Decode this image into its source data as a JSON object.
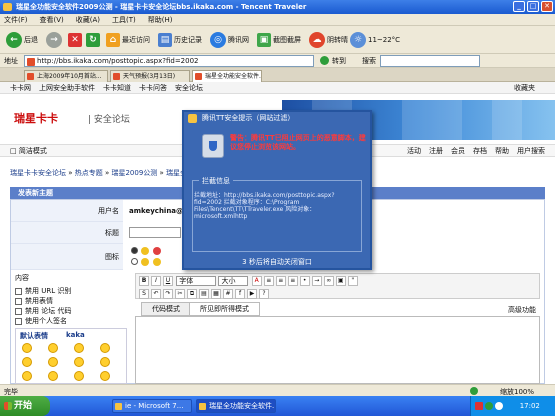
{
  "window": {
    "title": "瑞星全功能安全软件2009公测 - 瑞星卡卡安全论坛bbs.ikaka.com - Tencent Traveler"
  },
  "menu": [
    "文件(F)",
    "查看(V)",
    "收藏(A)",
    "工具(T)",
    "帮助(H)"
  ],
  "toolbar": {
    "back": "后退",
    "home_label": "最近访问",
    "history_label": "历史记录",
    "favorites_label": "腾讯网",
    "mute_label": "截图截屏",
    "weather_label": "阴转晴",
    "temperature": "11~22°C"
  },
  "address": {
    "label": "地址",
    "url": "http://bbs.ikaka.com/posttopic.aspx?fid=2002",
    "go": "转到",
    "search": "搜索"
  },
  "tabs": [
    "上海2009年10月首站...",
    "天气预报(3月13日)",
    "瑞星全功能安全软件..."
  ],
  "page": {
    "topnav": [
      "卡卡网",
      "上网安全助手软件",
      "卡卡知道",
      "卡卡问答",
      "安全论坛"
    ],
    "topnav_right": "收藏夹",
    "logo": "瑞星卡卡",
    "forum": "| 安全论坛",
    "subbar_left": "□ 简洁模式",
    "subbar_right": [
      "活动",
      "注册",
      "会员",
      "存档",
      "帮助",
      "用户搜索"
    ],
    "breadcrumbs": [
      "瑞星卡卡安全论坛",
      "热点专题",
      "瑞星2009公测",
      "瑞星全..."
    ],
    "panel_title": "发表新主题",
    "form": {
      "user_label": "用户名",
      "user_value": "amkeychina@gm",
      "title_label": "标题",
      "icon_label": "图标",
      "content_label": "内容",
      "options": [
        "禁用 URL 识别",
        "禁用表情",
        "禁用 论坛 代码",
        "使用个人签名"
      ],
      "smiley_tabs": [
        "默认表情",
        "kaka"
      ],
      "font_select": "字体",
      "size_select": "大小",
      "editor_tabs": [
        "代码模式",
        "所见即所得模式"
      ],
      "editor_right": "高级功能"
    }
  },
  "dialog": {
    "title": "腾讯TT安全提示（网站过滤）",
    "message": "警告：腾讯TT已阻止网页上的恶意脚本，建议您停止浏览该网站。",
    "box_title": "拦截信息",
    "detail": "拦截地址：http://bbs.ikaka.com/posttopic.aspx?fid=2002  拦截对象程序：C:\\Program Files\\Tencent\\TT\\TTraveler.exe  风险对象：microsoft.xmlhttp",
    "countdown": "3 秒后将自动关闭窗口"
  },
  "status": {
    "left": "完毕",
    "right": "缩放100%"
  },
  "taskbar": {
    "start": "开始",
    "tasks": [
      "ie - Microsoft 7...",
      "瑞星全功能安全软件..."
    ],
    "time": "17:02"
  }
}
